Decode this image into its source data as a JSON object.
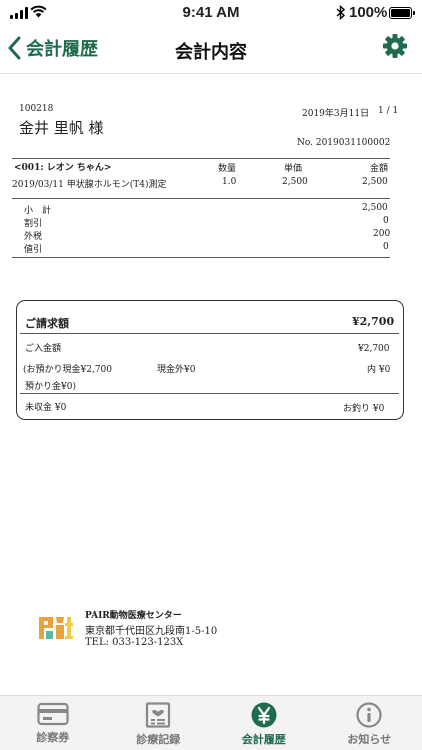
{
  "status_bar": {
    "time": "9:41 AM",
    "battery": "100%"
  },
  "nav": {
    "back_label": "会計履歴",
    "title": "会計内容"
  },
  "receipt": {
    "id": "100218",
    "date": "2019年3月11日",
    "page": "1 / 1",
    "customer": "金井 里帆 様",
    "number": "No. 2019031100002",
    "headers": {
      "qty": "数量",
      "unit_price": "単価",
      "amount": "金額"
    },
    "pet": "<001: レオン ちゃん>",
    "items": [
      {
        "description": "2019/03/11 甲状腺ホルモン(T4)測定",
        "qty": "1.0",
        "unit_price": "2,500",
        "amount": "2,500"
      }
    ],
    "summary": [
      {
        "label": "小　計",
        "value": "2,500"
      },
      {
        "label": "割引",
        "value": "0"
      },
      {
        "label": "外税",
        "value": "200"
      },
      {
        "label": "値引",
        "value": "0"
      }
    ]
  },
  "bill": {
    "label": "ご請求額",
    "amount": "¥2,700",
    "received_label": "ご入金額",
    "received_amount": "¥2,700",
    "cash_label": "(お預かり現金¥2,700",
    "non_cash_label": "現金外¥0",
    "inner_label": "内 ¥0",
    "deposit_label": "預かり金¥0)",
    "unpaid_label": "未収金 ¥0",
    "change_label": "お釣り ¥0"
  },
  "clinic": {
    "name": "PAIR動物医療センター",
    "address": "東京都千代田区九段南1-5-10",
    "tel": "TEL: 033-123-123X"
  },
  "tabs": [
    {
      "label": "診察券",
      "icon": "card-icon"
    },
    {
      "label": "診療記録",
      "icon": "records-icon"
    },
    {
      "label": "会計履歴",
      "icon": "yen-icon"
    },
    {
      "label": "お知らせ",
      "icon": "info-icon"
    }
  ],
  "colors": {
    "accent": "#1f6b4e",
    "tab_inactive": "#777777"
  }
}
